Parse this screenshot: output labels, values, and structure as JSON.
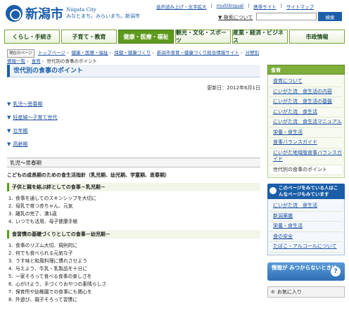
{
  "header": {
    "logo_text": "新潟市",
    "logo_en": "Niigata City",
    "tagline": "みなとまち。みらいまち。新潟市",
    "top_links": [
      "音声読み上げ・文字拡大",
      "multilingual",
      "携帯サイト",
      "サイトマップ"
    ],
    "search_label": "▼ 検索について",
    "search_placeholder": "",
    "search_button": "検索"
  },
  "nav": {
    "items": [
      "くらし・手続き",
      "子育て・教育",
      "健康・医療・福祉",
      "観光・文化・スポーツ",
      "産業・経済・ビジネス",
      "市政情報"
    ]
  },
  "breadcrumb": {
    "home": "現在のページ",
    "items": [
      "トップページ",
      "健康・医療・福祉",
      "保健・健康づくり",
      "新潟市食育・健康づくり総合情報サイト",
      "分野別情報一覧",
      "食育"
    ],
    "current": "世代別の食事のポイント"
  },
  "main": {
    "title": "世代別の食事のポイント",
    "updated": "更新日：2012年6月1日",
    "toc": [
      "乳児～思春期",
      "妊産婦～子育て世代",
      "壮年期",
      "高齢期"
    ],
    "section_heading": "乳児～思春期",
    "section_lead": "こどもの成長期のための食生活指針（乳児期、幼児期、学童期、思春期）",
    "sub1": {
      "heading": "子供と親を結ぶ絆としての食事－乳児期－",
      "items": [
        "食事を通してのスキンシップを大切に",
        "母乳で育つ赤ちゃん、元気",
        "離乳の完了、満1歳",
        "いつでも活用、母子健康手帳"
      ]
    },
    "sub2": {
      "heading": "食習慣の基礎づくりとしての食事－幼児期－",
      "items": [
        "食事のリズム大切、規則的に",
        "何でも食べられる元気な子",
        "うす味と和風料理に慣れさせよう",
        "与えよう、牛乳・乳製品を十分に",
        "一家そろって食べる食事の楽しさを",
        "心がけよう、手づくりおやつの素晴らしさ",
        "保育所や幼稚園での食事にも関心を",
        "外遊び、親子そろって習慣に"
      ]
    }
  },
  "sidebar": {
    "heading": "食育",
    "links": [
      "食育について",
      "にいがた流　食生活の内容",
      "にいがた流　食生活の基盤",
      "にいがた流　食生活",
      "にいがた流　食生活マニュアル",
      "栄養・食生活",
      "食事バランスガイド",
      "にいがた地域版食事バランスガイド",
      "世代別の食事のポイント"
    ],
    "current_index": 8,
    "related_heading": "このページをみている人はこんなページもみています",
    "related_links": [
      "にいがた流　食生活",
      "新潟薬膳",
      "栄養・食生活",
      "食の安全",
      "たばこ・アルコールについて"
    ],
    "banner_text": "情報が みつからないときは",
    "favorites_label": "お気に入り"
  }
}
